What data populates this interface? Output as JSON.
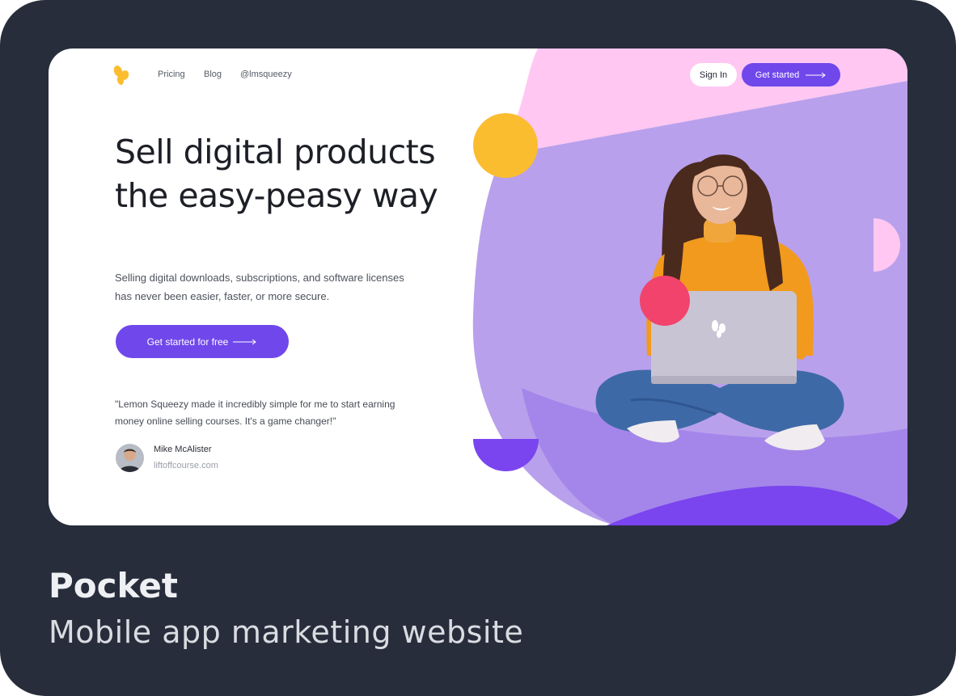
{
  "nav": {
    "links": [
      "Pricing",
      "Blog",
      "@lmsqueezy"
    ],
    "sign_in": "Sign In",
    "get_started": "Get started"
  },
  "hero": {
    "headline": "Sell digital products the easy-peasy way",
    "subtext": "Selling digital downloads, subscriptions, and software licenses has never been easier, faster, or more secure.",
    "cta": "Get started for free"
  },
  "testimonial": {
    "quote": "\"Lemon Squeezy made it incredibly simple for me to start earning money online selling courses. It's a game changer!\"",
    "author": "Mike McAlister",
    "site": "liftoffcourse.com"
  },
  "caption": {
    "title": "Pocket",
    "subtitle": "Mobile app marketing website"
  },
  "colors": {
    "card_bg": "#272d3b",
    "accent_purple": "#7047eb",
    "yellow": "#fbbd30",
    "pink": "#ffc7f2",
    "red": "#f2436c",
    "lavender": "#bfa3ed"
  },
  "icons": {
    "logo": "lemon-logo-icon",
    "arrow": "long-arrow-right-icon"
  }
}
